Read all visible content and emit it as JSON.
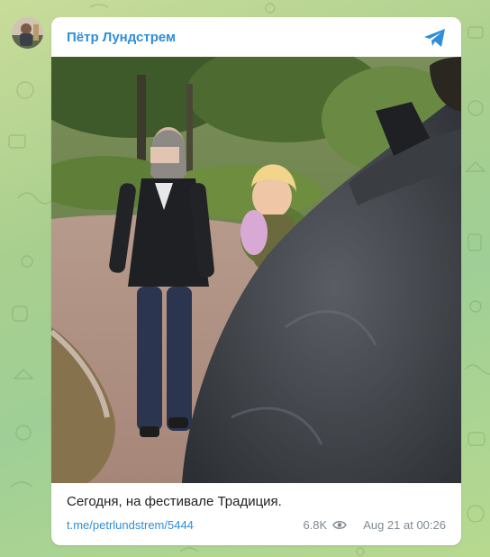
{
  "channel": {
    "name": "Пётр Лундстрем",
    "avatar_icon": "channel-avatar",
    "platform_icon": "telegram-icon"
  },
  "post": {
    "photo_icon": "post-photo",
    "caption": "Сегодня, на фестивале Традиция.",
    "link": "t.me/petrlundstrem/5444",
    "views": "6.8K",
    "views_icon": "eye-icon",
    "date": "Aug 21 at 00:26"
  },
  "colors": {
    "accent": "#2f8ed8",
    "meta_text": "#7f8a90",
    "background": "#a9cf8e",
    "card": "#ffffff"
  }
}
